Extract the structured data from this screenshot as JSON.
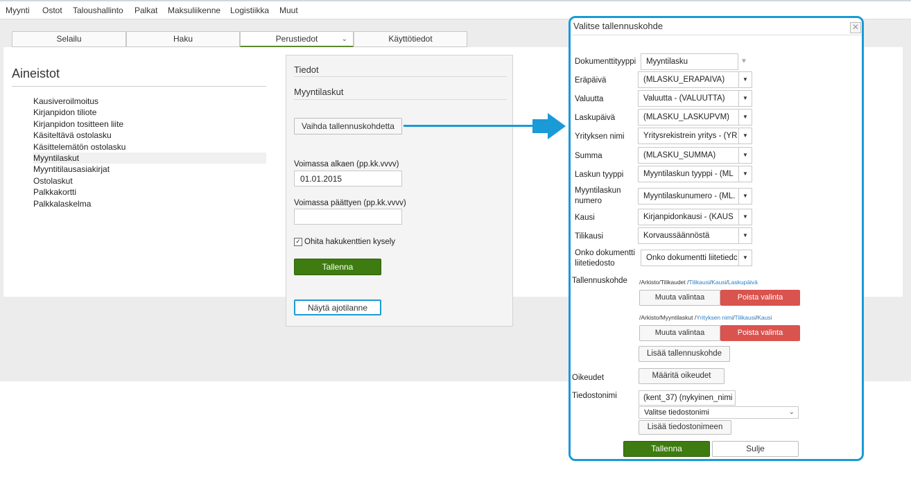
{
  "nav": {
    "items": [
      "Myynti",
      "Ostot",
      "Taloushallinto",
      "Palkat",
      "Maksuliikenne",
      "Logistiikka",
      "Muut"
    ]
  },
  "tabs": [
    "Selailu",
    "Haku",
    "Perustiedot",
    "Käyttötiedot"
  ],
  "aineistot": {
    "title": "Aineistot",
    "items": [
      "Kausiveroilmoitus",
      "Kirjanpidon tiliote",
      "Kirjanpidon tositteen liite",
      "Käsiteltävä ostolasku",
      "Käsittelemätön ostolasku",
      "Myyntilaskut",
      "Myyntitilausasiakirjat",
      "Ostolaskut",
      "Palkkakortti",
      "Palkkalaskelma"
    ],
    "selected_index": 5
  },
  "tiedot": {
    "title": "Tiedot",
    "subtitle": "Myyntilaskut",
    "change_button": "Vaihda tallennuskohdetta",
    "valid_from_label": "Voimassa alkaen (pp.kk.vvvv)",
    "valid_from_value": "01.01.2015",
    "valid_to_label": "Voimassa päättyen (pp.kk.vvvv)",
    "valid_to_value": "",
    "skip_checkbox_label": "Ohita hakukenttien kysely",
    "skip_checked": true,
    "save_button": "Tallenna",
    "show_status_button": "Näytä ajotilanne"
  },
  "dialog": {
    "title": "Valitse tallennuskohde",
    "close_icon": "close-icon",
    "fields": [
      {
        "label": "Dokumenttityyppi",
        "value": "Myyntilasku"
      },
      {
        "label": "Eräpäivä",
        "value": "(MLASKU_ERAPAIVA)"
      },
      {
        "label": "Valuutta",
        "value": "Valuutta - (VALUUTTA)"
      },
      {
        "label": "Laskupäivä",
        "value": "(MLASKU_LASKUPVM)"
      },
      {
        "label": "Yrityksen nimi",
        "value": "Yritysrekistrein yritys - (YR"
      },
      {
        "label": "Summa",
        "value": "(MLASKU_SUMMA)"
      },
      {
        "label": "Laskun tyyppi",
        "value": "Myyntilaskun tyyppi - (ML"
      },
      {
        "label": "Myyntilaskun numero",
        "value": "Myyntilaskunumero - (ML."
      },
      {
        "label": "Kausi",
        "value": "Kirjanpidonkausi - (KAUS"
      },
      {
        "label": "Tilikausi",
        "value": "Korvaussäännöstä"
      },
      {
        "label": "Onko dokumentti liitetiedosto",
        "value": "Onko dokumentti liitetiedc"
      }
    ],
    "tallennuskohde_label": "Tallennuskohde",
    "paths": [
      {
        "prefix": "/Arkisto/Tilikaudet /",
        "links": [
          "Tilikausi",
          "Kausi",
          "Laskupäivä"
        ]
      },
      {
        "prefix": "/Arkisto/Myyntilaskut /",
        "links": [
          "Yrityksen nimi",
          "Tilikausi",
          "Kausi"
        ]
      }
    ],
    "change_selection": "Muuta valintaa",
    "remove_selection": "Poista valinta",
    "add_target": "Lisää tallennuskohde",
    "rights_label": "Oikeudet",
    "rights_button": "Määritä oikeudet",
    "filename_label": "Tiedostonimi",
    "filename_value": "(kent_37) (nykyinen_nimi",
    "filename_select": "Valitse tiedostonimi",
    "add_to_filename": "Lisää tiedostonimeen",
    "save": "Tallenna",
    "close": "Sulje"
  },
  "colors": {
    "accent_blue": "#1a9ad7",
    "green": "#3e7b10",
    "red": "#d9534f"
  }
}
